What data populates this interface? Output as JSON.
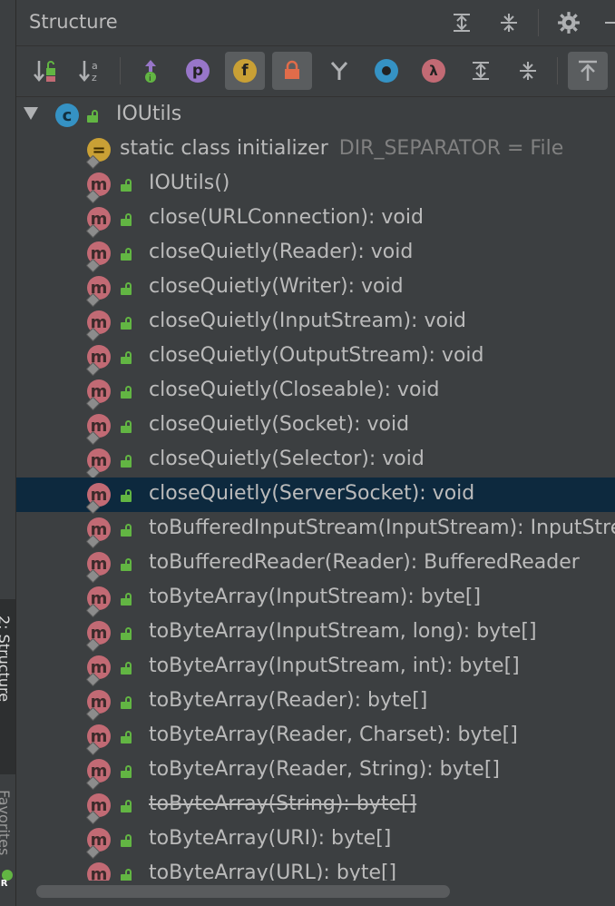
{
  "side_strip": {
    "tab_structure_label": "2: Structure",
    "tab_other_label": "Favorites",
    "bottom_logo": "JR"
  },
  "header": {
    "title": "Structure",
    "buttons": [
      {
        "name": "expand-all-icon"
      },
      {
        "name": "collapse-all-icon"
      },
      {
        "name": "gear-icon"
      },
      {
        "name": "minimize-icon"
      }
    ]
  },
  "toolbar": {
    "items": [
      {
        "name": "sort-by-visibility-icon",
        "pressed": false
      },
      {
        "name": "sort-alphabetically-icon",
        "pressed": false
      },
      {
        "name": "show-inherited-icon",
        "pressed": false
      },
      {
        "name": "show-properties-icon",
        "glyph": "p",
        "color": "#9876c9",
        "pressed": false
      },
      {
        "name": "show-fields-icon",
        "glyph": "f",
        "color": "#c9a035",
        "pressed": true
      },
      {
        "name": "show-non-public-icon",
        "pressed": true
      },
      {
        "name": "show-anonymous-icon",
        "pressed": false
      },
      {
        "name": "show-interfaces-icon",
        "pressed": false
      },
      {
        "name": "show-lambdas-icon",
        "glyph": "λ",
        "color": "#c26a74",
        "pressed": false
      },
      {
        "name": "expand-all-icon",
        "pressed": false
      },
      {
        "name": "collapse-all-icon",
        "pressed": false
      },
      {
        "name": "autoscroll-from-source-icon",
        "pressed": true
      }
    ]
  },
  "tree": {
    "root": {
      "label": "IOUtils",
      "badge": "c",
      "expanded": true
    },
    "initializer": {
      "label": "static class initializer",
      "hint": "DIR_SEPARATOR = File"
    },
    "items": [
      {
        "label": "IOUtils()",
        "deprecated": false
      },
      {
        "label": "close(URLConnection): void",
        "deprecated": false
      },
      {
        "label": "closeQuietly(Reader): void",
        "deprecated": false
      },
      {
        "label": "closeQuietly(Writer): void",
        "deprecated": false
      },
      {
        "label": "closeQuietly(InputStream): void",
        "deprecated": false
      },
      {
        "label": "closeQuietly(OutputStream): void",
        "deprecated": false
      },
      {
        "label": "closeQuietly(Closeable): void",
        "deprecated": false
      },
      {
        "label": "closeQuietly(Socket): void",
        "deprecated": false
      },
      {
        "label": "closeQuietly(Selector): void",
        "deprecated": false
      },
      {
        "label": "closeQuietly(ServerSocket): void",
        "deprecated": false,
        "selected": true
      },
      {
        "label": "toBufferedInputStream(InputStream): InputStream",
        "deprecated": false
      },
      {
        "label": "toBufferedReader(Reader): BufferedReader",
        "deprecated": false
      },
      {
        "label": "toByteArray(InputStream): byte[]",
        "deprecated": false
      },
      {
        "label": "toByteArray(InputStream, long): byte[]",
        "deprecated": false
      },
      {
        "label": "toByteArray(InputStream, int): byte[]",
        "deprecated": false
      },
      {
        "label": "toByteArray(Reader): byte[]",
        "deprecated": false
      },
      {
        "label": "toByteArray(Reader, Charset): byte[]",
        "deprecated": false
      },
      {
        "label": "toByteArray(Reader, String): byte[]",
        "deprecated": false
      },
      {
        "label": "toByteArray(String): byte[]",
        "deprecated": true
      },
      {
        "label": "toByteArray(URI): byte[]",
        "deprecated": false
      },
      {
        "label": "toByteArray(URL): byte[]",
        "deprecated": false
      }
    ]
  },
  "colors": {
    "background": "#3c3f41",
    "selection": "#0d293e",
    "method_badge": "#c26a74",
    "class_badge": "#3592c4",
    "public_lock": "#62b543"
  }
}
